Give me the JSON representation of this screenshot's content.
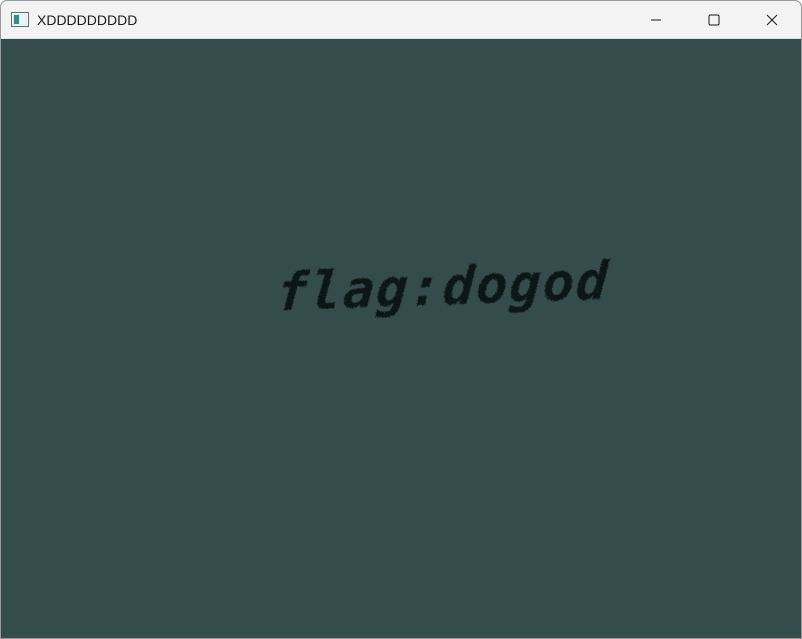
{
  "window": {
    "title": "XDDDDDDDDD",
    "icon": "app-window-icon",
    "controls": {
      "minimize_icon": "minimize-icon",
      "maximize_icon": "maximize-icon",
      "close_icon": "close-icon"
    }
  },
  "canvas": {
    "background_color": "#344d4c",
    "text": "flag:dogod",
    "text_color": "#101414"
  }
}
